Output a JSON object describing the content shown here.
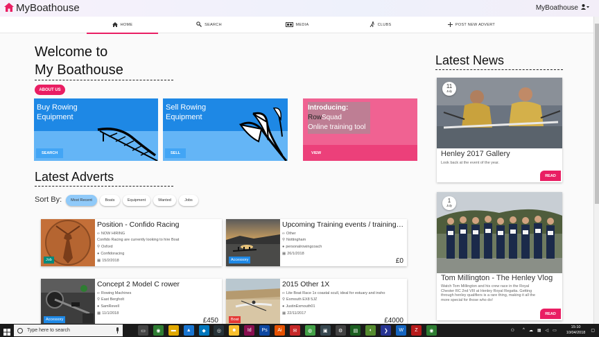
{
  "app": {
    "title": "MyBoathouse",
    "account_label": "MyBoathouse"
  },
  "nav": [
    {
      "label": "HOME",
      "icon": "home-icon"
    },
    {
      "label": "SEARCH",
      "icon": "search-icon"
    },
    {
      "label": "MEDIA",
      "icon": "media-icon"
    },
    {
      "label": "CLUBS",
      "icon": "rower-icon"
    },
    {
      "label": "POST NEW ADVERT",
      "icon": "plus-icon"
    }
  ],
  "welcome": {
    "line1": "Welcome to",
    "line2": "My Boathouse",
    "about_label": "ABOUT US"
  },
  "cards": {
    "buy": {
      "line1": "Buy Rowing",
      "line2": "Equipment",
      "button": "SEARCH"
    },
    "sell": {
      "line1": "Sell Rowing",
      "line2": "Equipment",
      "button": "SELL"
    },
    "rowsquad": {
      "line1": "Introducing:",
      "brand_a": "Row",
      "brand_b": "Squad",
      "line3": "Online training tool",
      "button": "VIEW"
    }
  },
  "adverts": {
    "heading": "Latest Adverts",
    "sort_label": "Sort By:",
    "sort_options": [
      "Most Recent",
      "Boats",
      "Equipment",
      "Wanted",
      "Jobs"
    ],
    "items": [
      {
        "title": "Position - Confido Racing",
        "category": "NOW HIRING",
        "description": "Confido Racing are currently looking to hire Boat",
        "location": "Oxford",
        "seller": "Confidoracing",
        "date": "15/2/2018",
        "price": "",
        "tag": "Job",
        "tag_color": "#00897b"
      },
      {
        "title": "Upcoming Training events / training camps",
        "category": "Other",
        "description": "",
        "location": "Nottingham",
        "seller": "personalrowingcoach",
        "date": "26/1/2018",
        "price": "£0",
        "tag": "Accessory",
        "tag_color": "#1e88e5"
      },
      {
        "title": "Concept 2 Model C rower",
        "category": "Rowing Machines",
        "description": "",
        "location": "East Bergholt",
        "seller": "SamRevell",
        "date": "11/1/2018",
        "price": "£450",
        "tag": "Accessory",
        "tag_color": "#1e88e5"
      },
      {
        "title": "2015 Other 1X",
        "category": "Lite Boat Race 1x coastal scull, ideal for estuary and insho",
        "description": "",
        "location": "Exmouth EX8 5JZ",
        "seller": "JustinExmouth01",
        "date": "22/11/2017",
        "price": "£4000",
        "tag": "Boat",
        "tag_color": "#e53935"
      }
    ]
  },
  "news": {
    "heading": "Latest News",
    "items": [
      {
        "day": "11",
        "month": "July",
        "title": "Henley 2017 Gallery",
        "description": "Look back at the event of the year.",
        "button": "READ"
      },
      {
        "day": "1",
        "month": "July",
        "title": "Tom Millington - The Henley Vlog",
        "description": "Watch Tom Millington and his crew race in the Royal Chester RC 2nd VIII at Henley Royal Regatta. Getting through henley qualifiers is a rare thing, making it all the more special for those who do!",
        "button": "READ"
      }
    ]
  },
  "taskbar": {
    "search_placeholder": "Type here to search",
    "time": "15:10",
    "date": "10/04/2018"
  },
  "colors": {
    "accent": "#e91e63",
    "blue_dark": "#1e88e5",
    "blue_light": "#64b5f6",
    "pink": "#f06292"
  }
}
